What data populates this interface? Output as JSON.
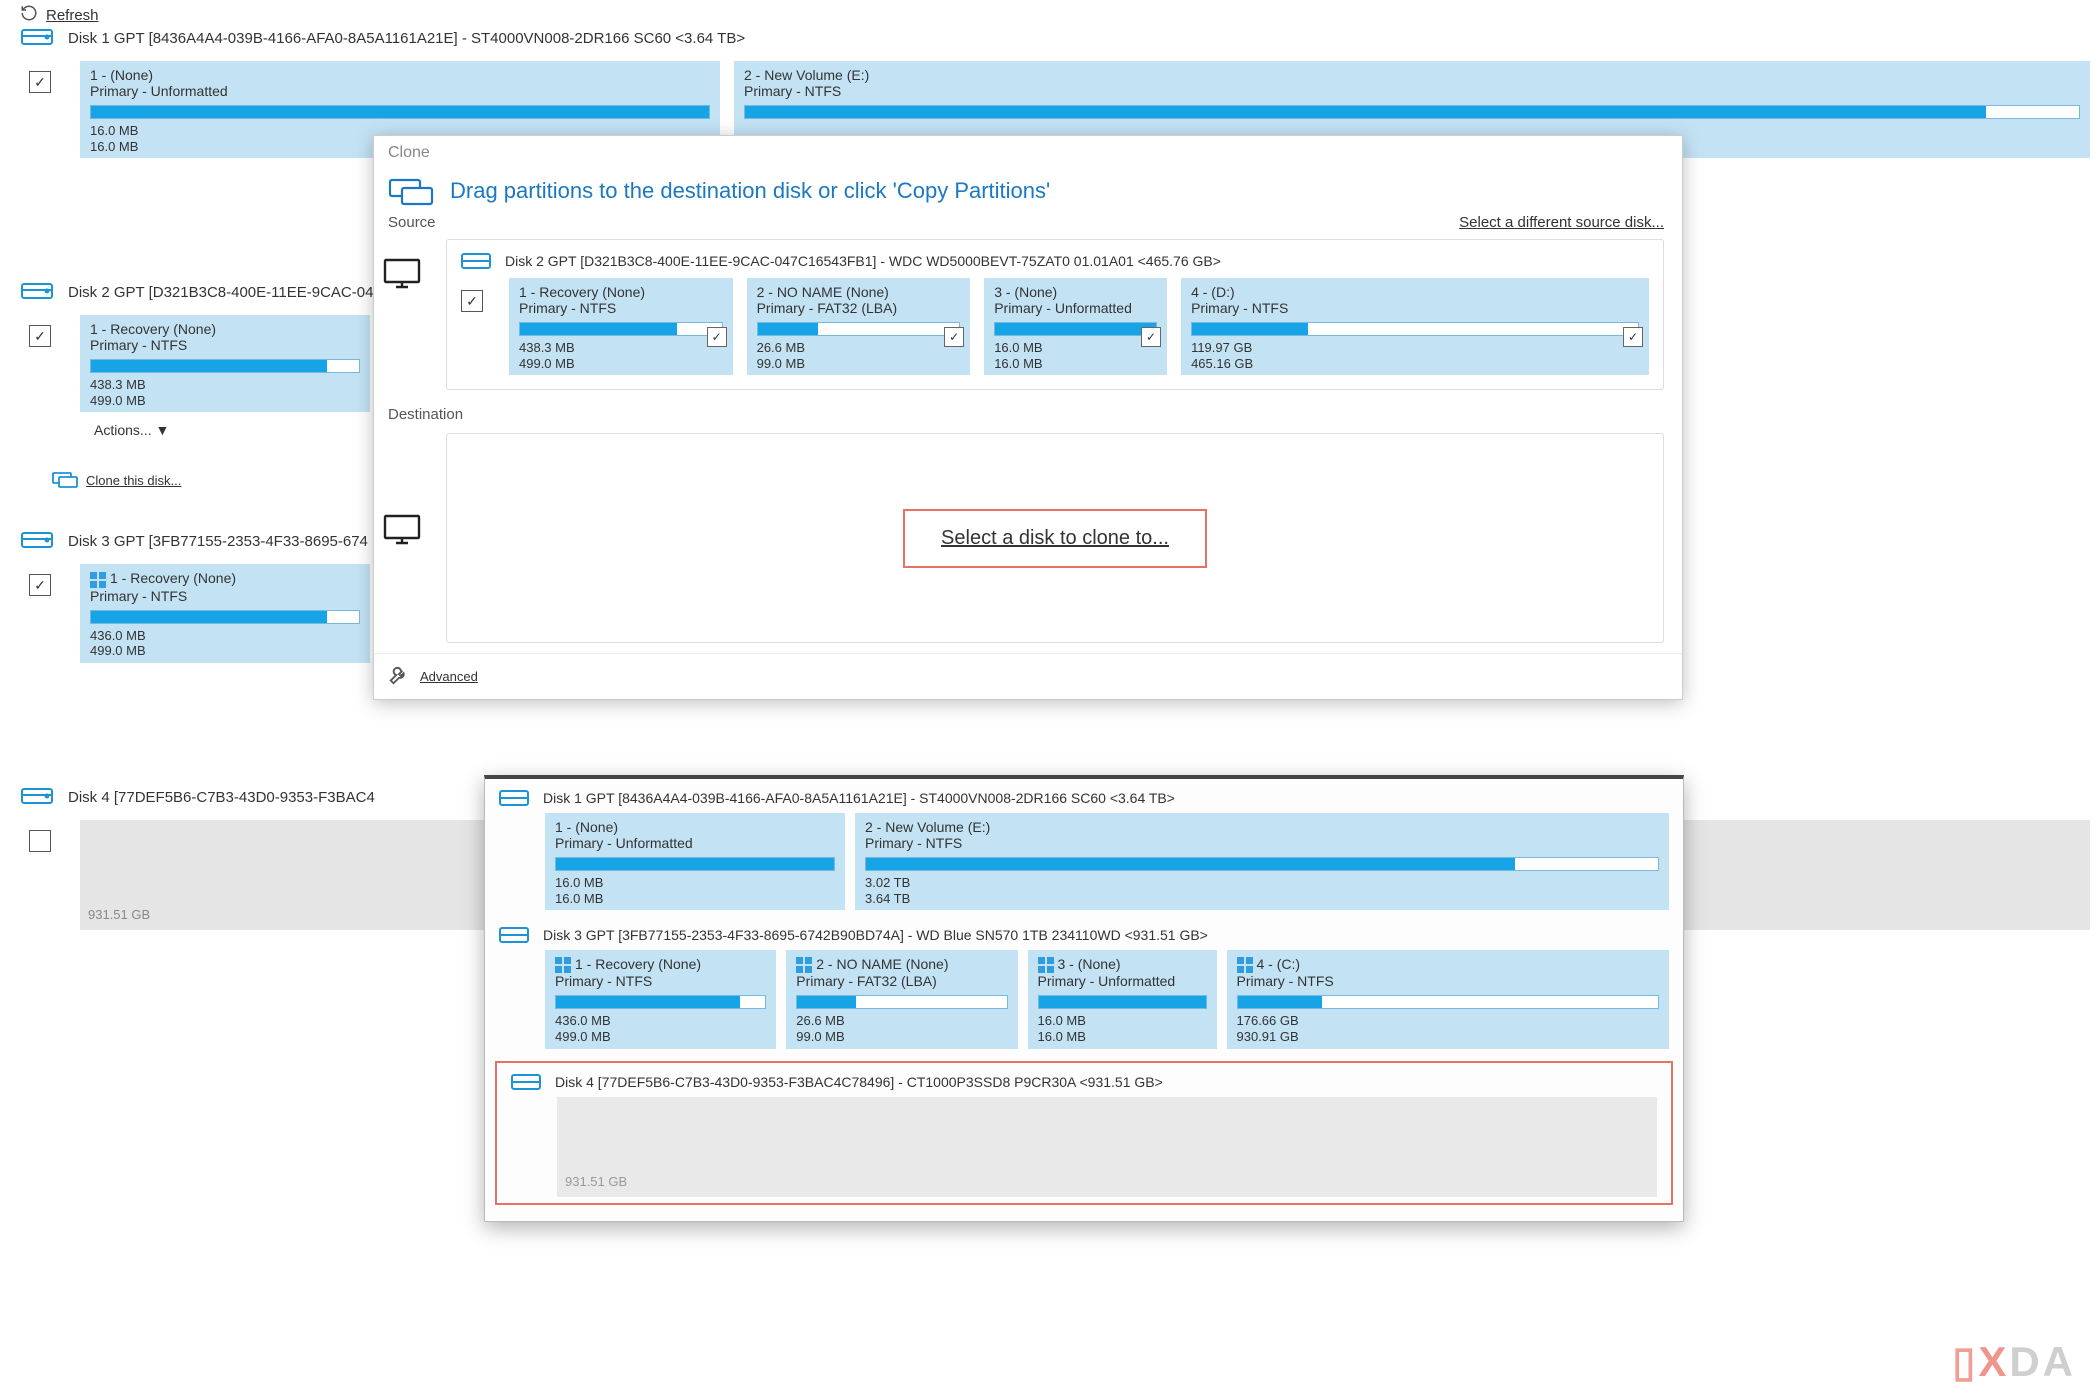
{
  "refresh_label": "Refresh",
  "actions_label": "Actions...",
  "clone_this_disk_label": "Clone this disk...",
  "advanced_label": "Advanced",
  "watermark": {
    "brand1": "X",
    "brand2": "DA"
  },
  "bg_disks": {
    "d1": {
      "title": "Disk 1 GPT [8436A4A4-039B-4166-AFA0-8A5A1161A21E] - ST4000VN008-2DR166 SC60  <3.64 TB>",
      "p1": {
        "name": "1 -  (None)",
        "type": "Primary - Unformatted",
        "used": "16.0 MB",
        "total": "16.0 MB",
        "fill": 100
      },
      "p2": {
        "name": "2 - New Volume (E:)",
        "type": "Primary - NTFS",
        "fill": 93
      }
    },
    "d2": {
      "title": "Disk 2 GPT [D321B3C8-400E-11EE-9CAC-04",
      "p1": {
        "name": "1 - Recovery (None)",
        "type": "Primary - NTFS",
        "used": "438.3 MB",
        "total": "499.0 MB",
        "fill": 88
      }
    },
    "d3": {
      "title": "Disk 3 GPT [3FB77155-2353-4F33-8695-674",
      "p1": {
        "name": "1 - Recovery (None)",
        "type": "Primary - NTFS",
        "used": "436.0 MB",
        "total": "499.0 MB",
        "fill": 88
      }
    },
    "d4": {
      "title": "Disk 4 [77DEF5B6-C7B3-43D0-9353-F3BAC4",
      "free": "931.51 GB"
    }
  },
  "modal": {
    "title": "Clone",
    "heading": "Drag partitions to the destination disk or click 'Copy Partitions'",
    "source_label": "Source",
    "dest_label": "Destination",
    "select_diff_source": "Select a different source disk...",
    "select_dest": "Select a disk to clone to...",
    "src_disk": {
      "title": "Disk 2 GPT [D321B3C8-400E-11EE-9CAC-047C16543FB1] - WDC WD5000BEVT-75ZAT0 01.01A01  <465.76 GB>",
      "p1": {
        "name": "1 - Recovery (None)",
        "type": "Primary - NTFS",
        "used": "438.3 MB",
        "total": "499.0 MB",
        "fill": 78
      },
      "p2": {
        "name": "2 - NO NAME (None)",
        "type": "Primary - FAT32 (LBA)",
        "used": "26.6 MB",
        "total": "99.0 MB",
        "fill": 30
      },
      "p3": {
        "name": "3 -  (None)",
        "type": "Primary - Unformatted",
        "used": "16.0 MB",
        "total": "16.0 MB",
        "fill": 100
      },
      "p4": {
        "name": "4 -  (D:)",
        "type": "Primary - NTFS",
        "used": "119.97 GB",
        "total": "465.16 GB",
        "fill": 26
      }
    }
  },
  "disk_list": {
    "d1": {
      "title": "Disk 1 GPT [8436A4A4-039B-4166-AFA0-8A5A1161A21E] - ST4000VN008-2DR166 SC60  <3.64 TB>",
      "p1": {
        "name": "1 -  (None)",
        "type": "Primary - Unformatted",
        "used": "16.0 MB",
        "total": "16.0 MB",
        "fill": 100
      },
      "p2": {
        "name": "2 - New Volume (E:)",
        "type": "Primary - NTFS",
        "used": "3.02 TB",
        "total": "3.64 TB",
        "fill": 82
      }
    },
    "d3": {
      "title": "Disk 3 GPT [3FB77155-2353-4F33-8695-6742B90BD74A] - WD Blue SN570 1TB 234110WD  <931.51 GB>",
      "p1": {
        "name": "1 - Recovery (None)",
        "type": "Primary - NTFS",
        "used": "436.0 MB",
        "total": "499.0 MB",
        "fill": 88
      },
      "p2": {
        "name": "2 - NO NAME (None)",
        "type": "Primary - FAT32 (LBA)",
        "used": "26.6 MB",
        "total": "99.0 MB",
        "fill": 28
      },
      "p3": {
        "name": "3 -  (None)",
        "type": "Primary - Unformatted",
        "used": "16.0 MB",
        "total": "16.0 MB",
        "fill": 100
      },
      "p4": {
        "name": "4 -  (C:)",
        "type": "Primary - NTFS",
        "used": "176.66 GB",
        "total": "930.91 GB",
        "fill": 20
      }
    },
    "d4": {
      "title": "Disk 4 [77DEF5B6-C7B3-43D0-9353-F3BAC4C78496] - CT1000P3SSD8 P9CR30A  <931.51 GB>",
      "free": "931.51 GB"
    }
  }
}
